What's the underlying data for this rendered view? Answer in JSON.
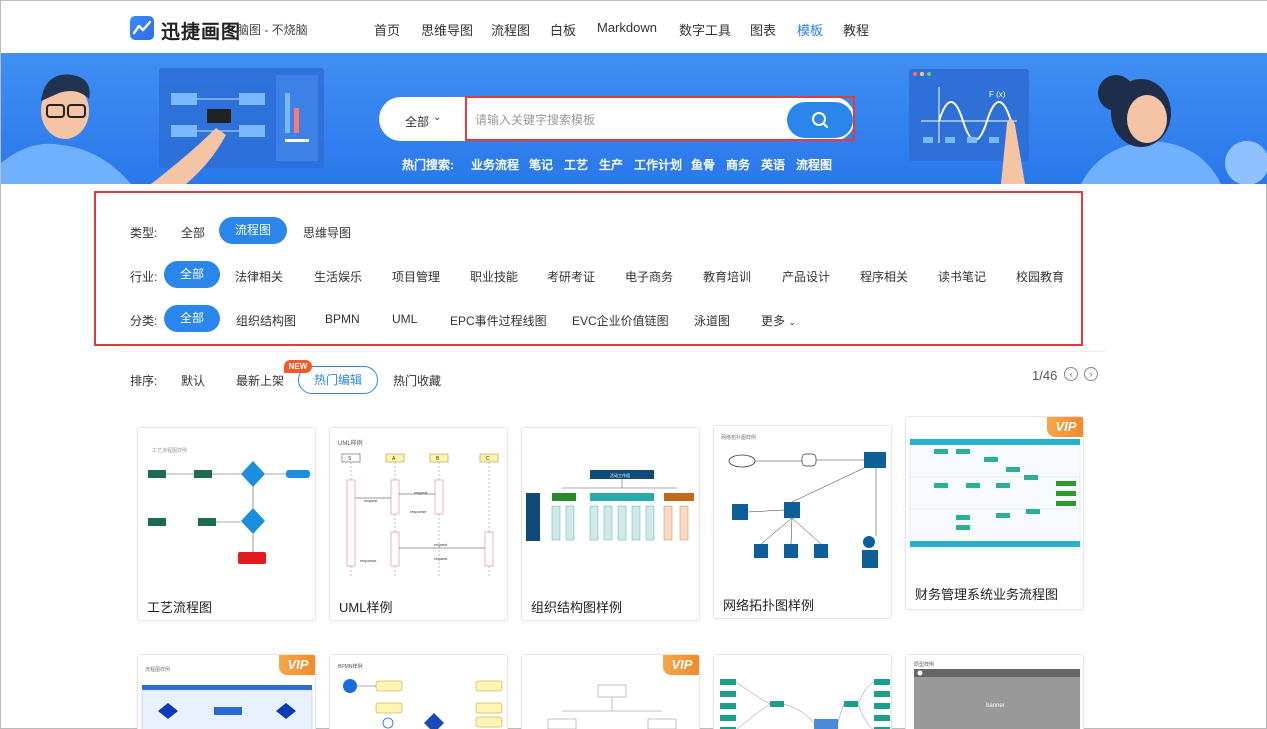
{
  "app": {
    "logo_text": "迅捷画图",
    "logo_sub": "脑图 - 不烧脑"
  },
  "nav": {
    "items": [
      "首页",
      "思维导图",
      "流程图",
      "白板",
      "Markdown",
      "数字工具",
      "图表",
      "模板",
      "教程"
    ],
    "active": "模板"
  },
  "search": {
    "scope": "全部",
    "placeholder": "请输入关键字搜索模板",
    "value": ""
  },
  "hot": {
    "label": "热门搜索:",
    "items": [
      "业务流程",
      "笔记",
      "工艺",
      "生产",
      "工作计划",
      "鱼骨",
      "商务",
      "英语",
      "流程图"
    ]
  },
  "filters": {
    "type_label": "类型:",
    "types": [
      "全部",
      "流程图",
      "思维导图"
    ],
    "industry_label": "行业:",
    "industries": [
      "全部",
      "法律相关",
      "生活娱乐",
      "项目管理",
      "职业技能",
      "考研考证",
      "电子商务",
      "教育培训",
      "产品设计",
      "程序相关",
      "读书笔记",
      "校园教育"
    ],
    "category_label": "分类:",
    "categories": [
      "全部",
      "组织结构图",
      "BPMN",
      "UML",
      "EPC事件过程线图",
      "EVC企业价值链图",
      "泳道图",
      "更多"
    ]
  },
  "sort": {
    "label": "排序:",
    "items": [
      "默认",
      "最新上架",
      "热门编辑",
      "热门收藏"
    ],
    "new_badge": "NEW",
    "page": "1/46"
  },
  "cards": [
    {
      "title": "工艺流程图",
      "vip": false,
      "caption": "工艺流程图样例"
    },
    {
      "title": "UML样例",
      "vip": false,
      "caption": "UML样例"
    },
    {
      "title": "组织结构图样例",
      "vip": false,
      "caption": "活动工作组"
    },
    {
      "title": "网络拓扑图样例",
      "vip": false,
      "caption": "网络拓扑图样例"
    },
    {
      "title": "财务管理系统业务流程图",
      "vip": true,
      "caption": ""
    },
    {
      "title": "",
      "vip": true,
      "caption": "流程图样例"
    },
    {
      "title": "",
      "vip": false,
      "caption": "BPMN样例"
    },
    {
      "title": "",
      "vip": true,
      "caption": ""
    },
    {
      "title": "",
      "vip": false,
      "caption": ""
    },
    {
      "title": "",
      "vip": false,
      "caption": "原型样例",
      "banner_text": "banner"
    }
  ],
  "vip_label": "VIP",
  "uml": {
    "lanes": [
      "S",
      "A",
      "B",
      "C"
    ],
    "msgs": [
      "request",
      "response",
      "request",
      "response",
      "request",
      "request"
    ]
  },
  "banner_chart_label": "F (x)"
}
